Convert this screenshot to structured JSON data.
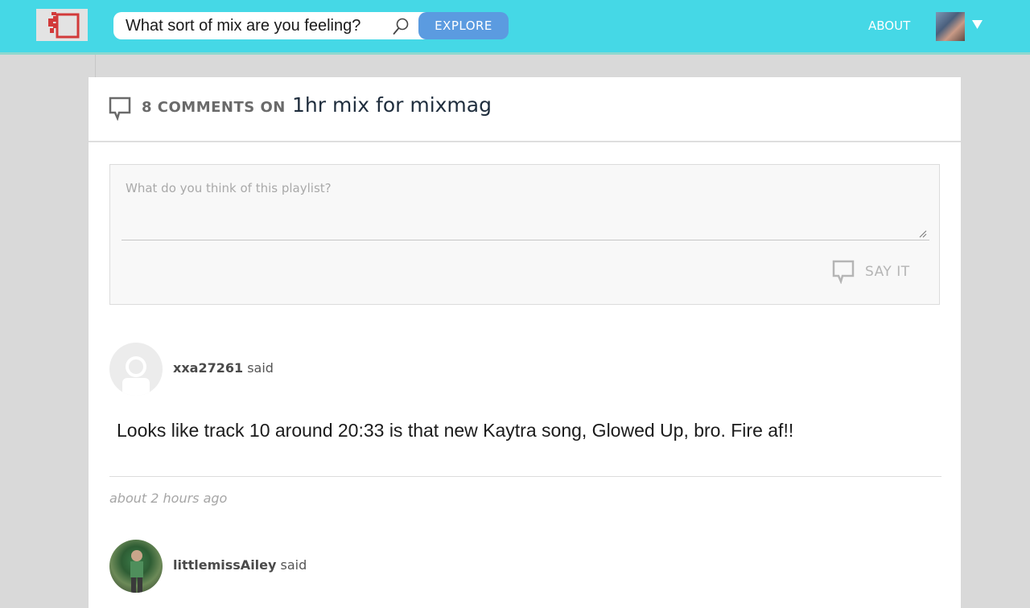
{
  "header": {
    "search_placeholder": "What sort of mix are you feeling?",
    "explore_label": "EXPLORE",
    "about_label": "ABOUT",
    "accent_color": "#45d8e6",
    "button_color": "#5b9be0"
  },
  "comments_section": {
    "count_label": "8 COMMENTS ON",
    "playlist_title": "1hr mix for mixmag",
    "form": {
      "placeholder": "What do you think of this playlist?",
      "submit_label": "SAY IT"
    },
    "comments": [
      {
        "username": "xxa27261",
        "said": "said",
        "text": "Looks like track 10 around 20:33 is that new Kaytra song, Glowed Up, bro. Fire af!!",
        "time": "about 2 hours ago"
      },
      {
        "username": "littlemissAiley",
        "said": "said"
      }
    ]
  }
}
